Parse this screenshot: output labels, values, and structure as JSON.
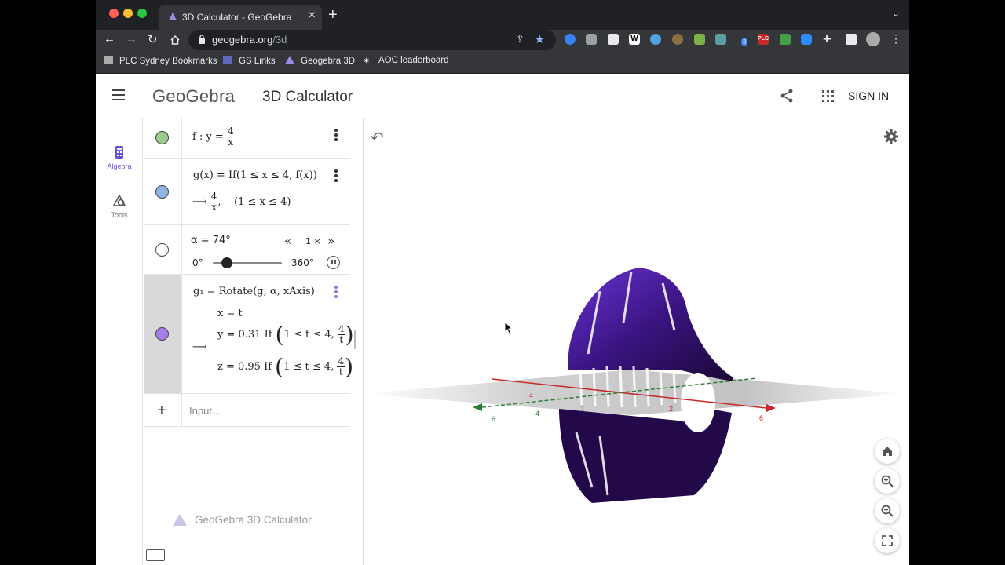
{
  "browser": {
    "tab_title": "3D Calculator - GeoGebra",
    "url_host": "geogebra.org",
    "url_path": "/3d",
    "bookmarks": [
      "PLC Sydney Bookmarks",
      "GS Links",
      "Geogebra 3D",
      "AOC leaderboard"
    ],
    "ext_badge": "3",
    "ext_plc": "PLC"
  },
  "header": {
    "logo": "GeoGebra",
    "title": "3D Calculator",
    "sign_in": "SIGN IN"
  },
  "rail": {
    "algebra": "Algebra",
    "tools": "Tools"
  },
  "algebra": {
    "f": {
      "lhs": "f : y =",
      "num": "4",
      "den": "x"
    },
    "g": {
      "def": "g(x) = If(1 ≤ x ≤ 4, f(x))",
      "arrow": "⟶",
      "num": "4",
      "den": "x",
      "cond": ",    (1 ≤ x ≤ 4)"
    },
    "alpha": {
      "label": "α = 74°",
      "speed": "1 ×",
      "min": "0°",
      "max": "360°",
      "value": 74
    },
    "g1": {
      "def": "g₁ = Rotate(g, α, xAxis)",
      "x": "x = t",
      "y_prefix": "y = 0.31 If",
      "z_prefix": "z = 0.95 If",
      "cond": "1 ≤ t ≤ 4,",
      "num": "4",
      "den": "t",
      "arrow": "⟶"
    },
    "input_placeholder": "Input..."
  },
  "footer": {
    "app_name": "GeoGebra 3D Calculator"
  },
  "axes": {
    "x_labels": [
      "4",
      "2",
      "6"
    ],
    "y_labels": [
      "6",
      "4",
      "2"
    ]
  },
  "colors": {
    "f_dot": "#9ccc8c",
    "g_dot": "#8fb5e8",
    "g1_dot": "#a57ee6",
    "surface_dark": "#1d0a3a",
    "surface_light": "#5a28b8"
  }
}
